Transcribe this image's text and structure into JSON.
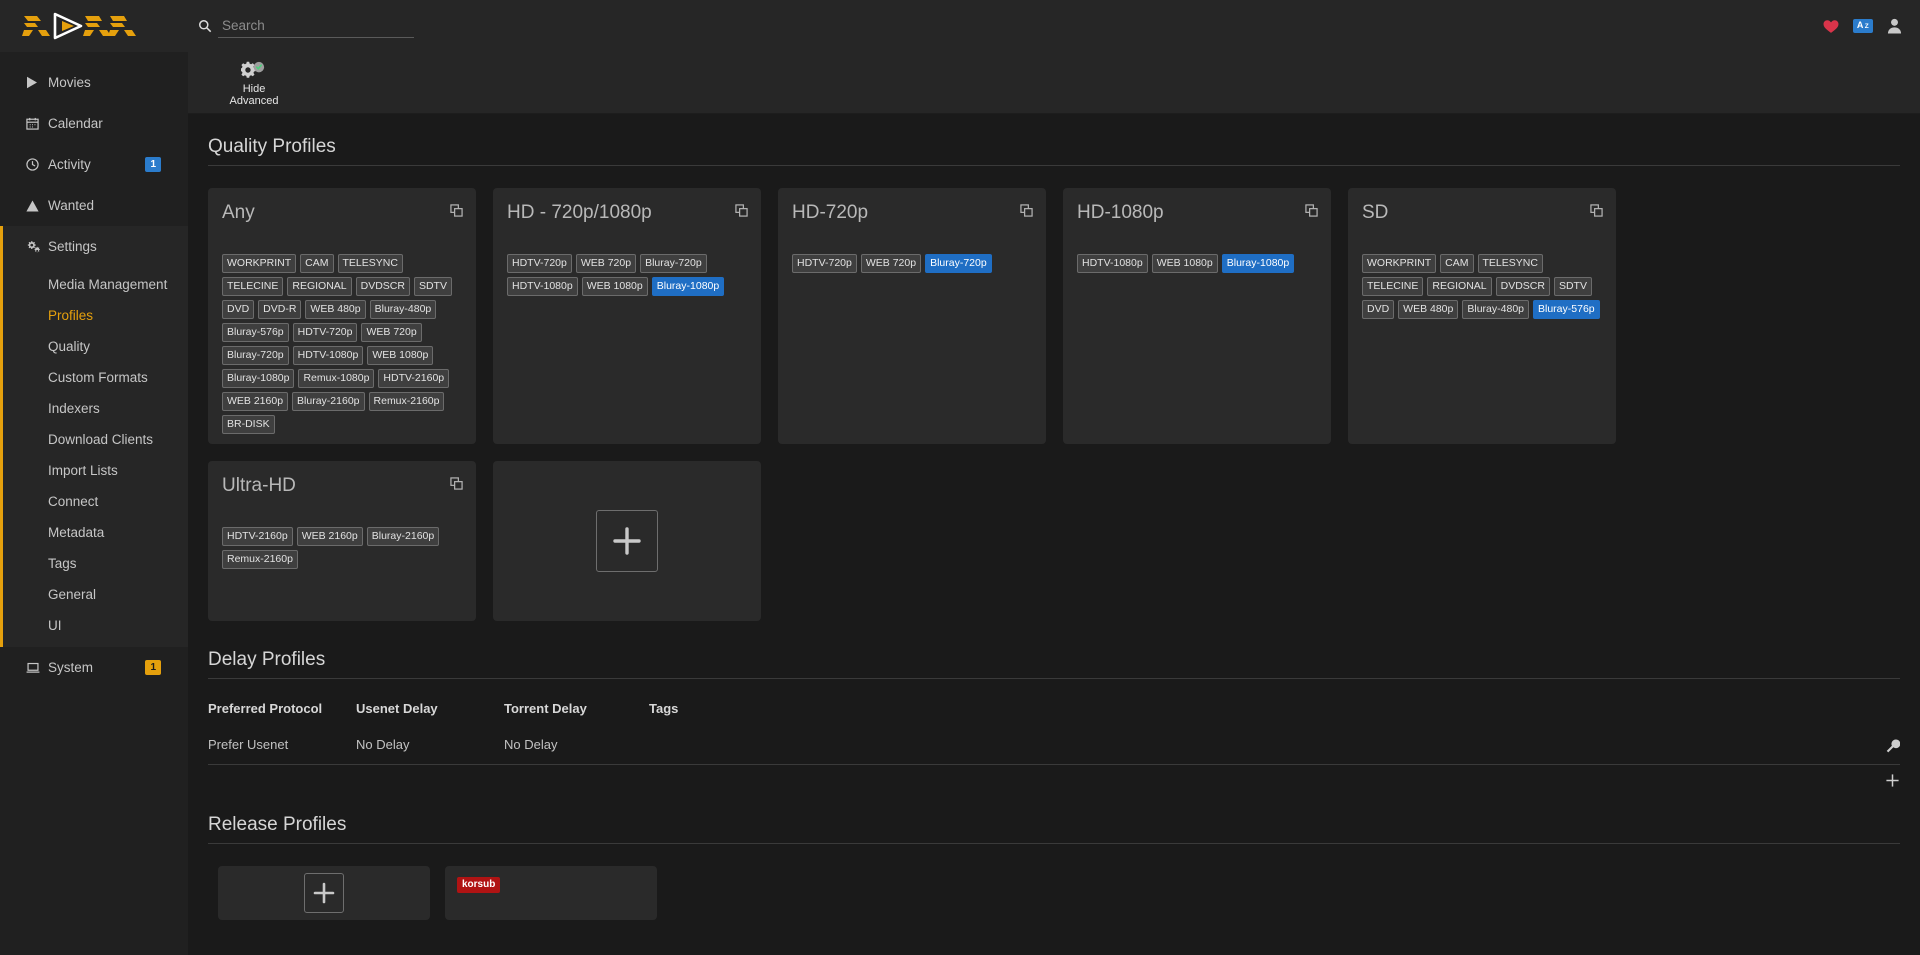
{
  "header": {
    "brand": "RADARR",
    "search": {
      "placeholder": "Search",
      "value": ""
    },
    "icons": {
      "search": "search-icon",
      "donate": "heart-icon",
      "sort": "a-z-icon",
      "account": "user-icon"
    },
    "sort_badge": {
      "main": "A",
      "sup": "Z"
    },
    "accent": "#e5a00d",
    "info_color": "#2b7ccc"
  },
  "sidebar": {
    "items": [
      {
        "label": "Movies",
        "icon": "play-icon",
        "badge": null,
        "active": false
      },
      {
        "label": "Calendar",
        "icon": "calendar-icon",
        "badge": null,
        "active": false
      },
      {
        "label": "Activity",
        "icon": "clock-icon",
        "badge": "1",
        "badge_type": "info",
        "active": false
      },
      {
        "label": "Wanted",
        "icon": "alert-triangle-icon",
        "badge": null,
        "active": false
      },
      {
        "label": "Settings",
        "icon": "gears-icon",
        "badge": null,
        "active": true
      },
      {
        "label": "System",
        "icon": "laptop-icon",
        "badge": "1",
        "badge_type": "warn",
        "active": false
      }
    ],
    "subitems": [
      {
        "label": "Media Management",
        "active": false
      },
      {
        "label": "Profiles",
        "active": true
      },
      {
        "label": "Quality",
        "active": false
      },
      {
        "label": "Custom Formats",
        "active": false
      },
      {
        "label": "Indexers",
        "active": false
      },
      {
        "label": "Download Clients",
        "active": false
      },
      {
        "label": "Import Lists",
        "active": false
      },
      {
        "label": "Connect",
        "active": false
      },
      {
        "label": "Metadata",
        "active": false
      },
      {
        "label": "Tags",
        "active": false
      },
      {
        "label": "General",
        "active": false
      },
      {
        "label": "UI",
        "active": false
      }
    ]
  },
  "toolbar": {
    "advanced_button": {
      "line1": "Hide",
      "line2": "Advanced",
      "icon": "gear-check-icon"
    }
  },
  "quality_profiles": {
    "title": "Quality Profiles",
    "add_label": "+",
    "cards": [
      {
        "name": "Any",
        "clone_icon": "clone-icon",
        "qualities": [
          {
            "label": "WORKPRINT",
            "cutoff": false
          },
          {
            "label": "CAM",
            "cutoff": false
          },
          {
            "label": "TELESYNC",
            "cutoff": false
          },
          {
            "label": "TELECINE",
            "cutoff": false
          },
          {
            "label": "REGIONAL",
            "cutoff": false
          },
          {
            "label": "DVDSCR",
            "cutoff": false
          },
          {
            "label": "SDTV",
            "cutoff": false
          },
          {
            "label": "DVD",
            "cutoff": false
          },
          {
            "label": "DVD-R",
            "cutoff": false
          },
          {
            "label": "WEB 480p",
            "cutoff": false
          },
          {
            "label": "Bluray-480p",
            "cutoff": false
          },
          {
            "label": "Bluray-576p",
            "cutoff": false
          },
          {
            "label": "HDTV-720p",
            "cutoff": false
          },
          {
            "label": "WEB 720p",
            "cutoff": false
          },
          {
            "label": "Bluray-720p",
            "cutoff": false
          },
          {
            "label": "HDTV-1080p",
            "cutoff": false
          },
          {
            "label": "WEB 1080p",
            "cutoff": false
          },
          {
            "label": "Bluray-1080p",
            "cutoff": false
          },
          {
            "label": "Remux-1080p",
            "cutoff": false
          },
          {
            "label": "HDTV-2160p",
            "cutoff": false
          },
          {
            "label": "WEB 2160p",
            "cutoff": false
          },
          {
            "label": "Bluray-2160p",
            "cutoff": false
          },
          {
            "label": "Remux-2160p",
            "cutoff": false
          },
          {
            "label": "BR-DISK",
            "cutoff": false
          }
        ]
      },
      {
        "name": "HD - 720p/1080p",
        "clone_icon": "clone-icon",
        "qualities": [
          {
            "label": "HDTV-720p",
            "cutoff": false
          },
          {
            "label": "WEB 720p",
            "cutoff": false
          },
          {
            "label": "Bluray-720p",
            "cutoff": false
          },
          {
            "label": "HDTV-1080p",
            "cutoff": false
          },
          {
            "label": "WEB 1080p",
            "cutoff": false
          },
          {
            "label": "Bluray-1080p",
            "cutoff": true
          }
        ]
      },
      {
        "name": "HD-720p",
        "clone_icon": "clone-icon",
        "qualities": [
          {
            "label": "HDTV-720p",
            "cutoff": false
          },
          {
            "label": "WEB 720p",
            "cutoff": false
          },
          {
            "label": "Bluray-720p",
            "cutoff": true
          }
        ]
      },
      {
        "name": "HD-1080p",
        "clone_icon": "clone-icon",
        "qualities": [
          {
            "label": "HDTV-1080p",
            "cutoff": false
          },
          {
            "label": "WEB 1080p",
            "cutoff": false
          },
          {
            "label": "Bluray-1080p",
            "cutoff": true
          }
        ]
      },
      {
        "name": "SD",
        "clone_icon": "clone-icon",
        "qualities": [
          {
            "label": "WORKPRINT",
            "cutoff": false
          },
          {
            "label": "CAM",
            "cutoff": false
          },
          {
            "label": "TELESYNC",
            "cutoff": false
          },
          {
            "label": "TELECINE",
            "cutoff": false
          },
          {
            "label": "REGIONAL",
            "cutoff": false
          },
          {
            "label": "DVDSCR",
            "cutoff": false
          },
          {
            "label": "SDTV",
            "cutoff": false
          },
          {
            "label": "DVD",
            "cutoff": false
          },
          {
            "label": "WEB 480p",
            "cutoff": false
          },
          {
            "label": "Bluray-480p",
            "cutoff": false
          },
          {
            "label": "Bluray-576p",
            "cutoff": true
          }
        ]
      },
      {
        "name": "Ultra-HD",
        "clone_icon": "clone-icon",
        "qualities": [
          {
            "label": "HDTV-2160p",
            "cutoff": false
          },
          {
            "label": "WEB 2160p",
            "cutoff": false
          },
          {
            "label": "Bluray-2160p",
            "cutoff": false
          },
          {
            "label": "Remux-2160p",
            "cutoff": false
          }
        ]
      }
    ]
  },
  "delay_profiles": {
    "title": "Delay Profiles",
    "columns": [
      "Preferred Protocol",
      "Usenet Delay",
      "Torrent Delay",
      "Tags"
    ],
    "rows": [
      {
        "protocol": "Prefer Usenet",
        "usenet": "No Delay",
        "torrent": "No Delay",
        "tags": ""
      }
    ],
    "row_action_icon": "wrench-icon",
    "add_icon": "plus-icon"
  },
  "release_profiles": {
    "title": "Release Profiles",
    "add_label": "+",
    "cards": [
      {
        "type": "add"
      },
      {
        "type": "profile",
        "tags": [
          {
            "label": "korsub",
            "color": "#b01313"
          }
        ]
      }
    ]
  }
}
